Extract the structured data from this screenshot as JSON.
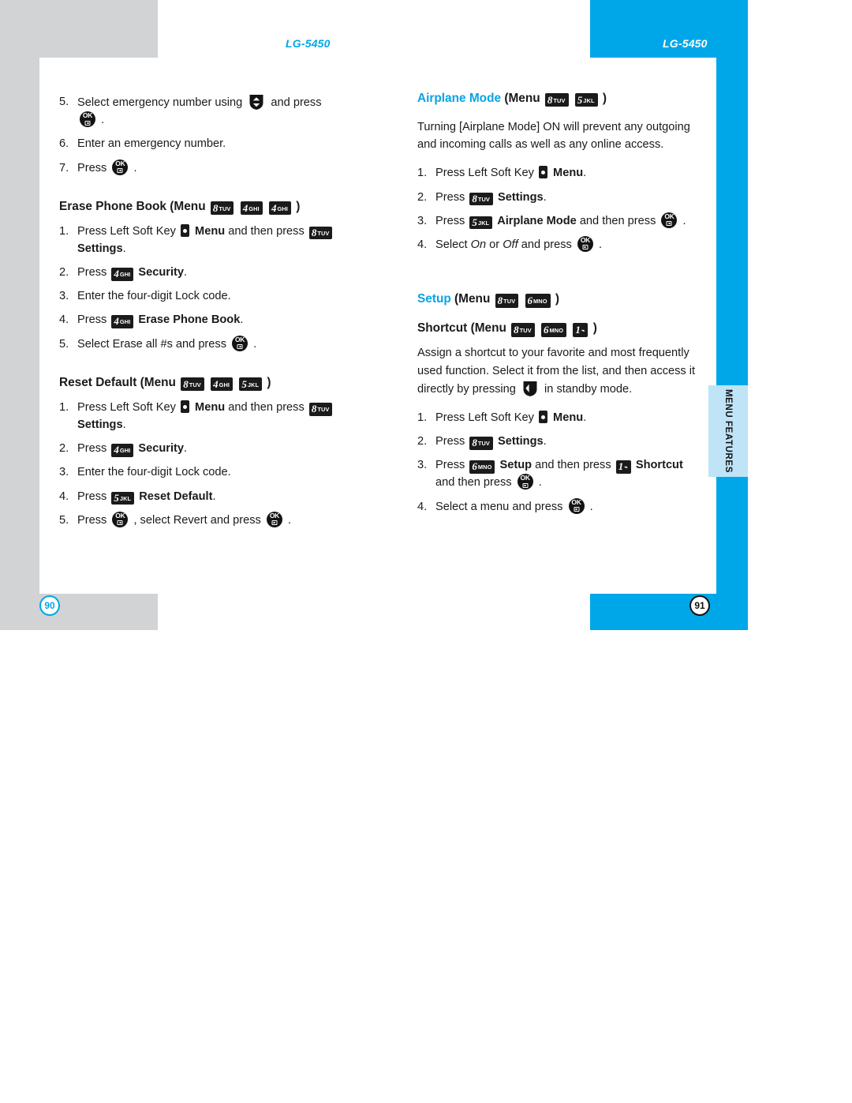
{
  "document": {
    "running_head_left": "LG-5450",
    "running_head_right": "LG-5450",
    "folio_left": "90",
    "folio_right": "91",
    "thumb_tab": "Menu Features"
  },
  "colors": {
    "accent_blue": "#00a7e8",
    "tab_light_blue": "#bfe3f7",
    "page_gray": "#d2d3d4",
    "key_black": "#1b1b1b"
  },
  "left_page": {
    "continued_steps": [
      {
        "num": "5.",
        "a": "Select emergency number using",
        "b": "and press",
        "c": "."
      },
      {
        "num": "6.",
        "a": "Enter an emergency number."
      },
      {
        "num": "7.",
        "a": "Press",
        "c": "."
      }
    ],
    "erase_phone_book": {
      "title": "Erase Phone Book",
      "paren_open": "(Menu",
      "paren_close": ")",
      "keys": [
        {
          "digit": "8",
          "letters": "TUV"
        },
        {
          "digit": "4",
          "letters": "GHI"
        },
        {
          "digit": "4",
          "letters": "GHI"
        }
      ],
      "steps": [
        {
          "num": "1.",
          "a": "Press Left Soft Key",
          "b": "Menu",
          "c": "and then press",
          "d": "Settings",
          "e": "."
        },
        {
          "num": "2.",
          "a": "Press",
          "b": "Security",
          "c": "."
        },
        {
          "num": "3.",
          "a": "Enter the four-digit Lock code."
        },
        {
          "num": "4.",
          "a": "Press",
          "b": "Erase Phone Book",
          "c": "."
        },
        {
          "num": "5.",
          "a": "Select Erase all #s and press",
          "c": "."
        }
      ],
      "step1_key": {
        "digit": "8",
        "letters": "TUV"
      },
      "step2_key": {
        "digit": "4",
        "letters": "GHI"
      },
      "step4_key": {
        "digit": "4",
        "letters": "GHI"
      }
    },
    "reset_default": {
      "title": "Reset Default",
      "paren_open": "(Menu",
      "paren_close": ")",
      "keys": [
        {
          "digit": "8",
          "letters": "TUV"
        },
        {
          "digit": "4",
          "letters": "GHI"
        },
        {
          "digit": "5",
          "letters": "JKL"
        }
      ],
      "steps": [
        {
          "num": "1.",
          "a": "Press Left Soft Key",
          "b": "Menu",
          "c": "and then press",
          "d": "Settings",
          "e": "."
        },
        {
          "num": "2.",
          "a": "Press",
          "b": "Security",
          "c": "."
        },
        {
          "num": "3.",
          "a": "Enter the four-digit Lock code."
        },
        {
          "num": "4.",
          "a": "Press",
          "b": "Reset Default",
          "c": "."
        },
        {
          "num": "5.",
          "a": "Press",
          "b": ", select Revert and press",
          "c": "."
        }
      ],
      "step1_key": {
        "digit": "8",
        "letters": "TUV"
      },
      "step2_key": {
        "digit": "4",
        "letters": "GHI"
      },
      "step4_key": {
        "digit": "5",
        "letters": "JKL"
      }
    }
  },
  "right_page": {
    "airplane_mode": {
      "title": "Airplane Mode",
      "paren_open": "(Menu",
      "paren_close": ")",
      "keys": [
        {
          "digit": "8",
          "letters": "TUV"
        },
        {
          "digit": "5",
          "letters": "JKL"
        }
      ],
      "body": "Turning [Airplane Mode] ON will prevent any outgoing and incoming calls as well as any online access.",
      "steps": [
        {
          "num": "1.",
          "a": "Press Left Soft Key",
          "b": "Menu",
          "c": "."
        },
        {
          "num": "2.",
          "a": "Press",
          "b": "Settings",
          "c": "."
        },
        {
          "num": "3.",
          "a": "Press",
          "b": "Airplane Mode",
          "c": "and then press",
          "e": "."
        },
        {
          "num": "4.",
          "a": "Select",
          "b": "On",
          "c": "or",
          "d": "Off",
          "e": "and press",
          "f": "."
        }
      ],
      "step2_key": {
        "digit": "8",
        "letters": "TUV"
      },
      "step3_key": {
        "digit": "5",
        "letters": "JKL"
      }
    },
    "setup": {
      "title": "Setup",
      "paren_open": "(Menu",
      "paren_close": ")",
      "keys": [
        {
          "digit": "8",
          "letters": "TUV"
        },
        {
          "digit": "6",
          "letters": "MNO"
        }
      ]
    },
    "shortcut": {
      "title": "Shortcut",
      "paren_open": "(Menu",
      "paren_close": ")",
      "keys": [
        {
          "digit": "8",
          "letters": "TUV"
        },
        {
          "digit": "6",
          "letters": "MNO"
        },
        {
          "digit": "1",
          "letters": ""
        }
      ],
      "body_a": "Assign a shortcut to your favorite and most frequently used function. Select it from the list, and then access it directly by pressing",
      "body_b": "in standby mode.",
      "steps": [
        {
          "num": "1.",
          "a": "Press Left Soft Key",
          "b": "Menu",
          "c": "."
        },
        {
          "num": "2.",
          "a": "Press",
          "b": "Settings",
          "c": "."
        },
        {
          "num": "3.",
          "a": "Press",
          "b": "Setup",
          "c": "and then press",
          "d": "Shortcut",
          "e": "and then press",
          "f": "."
        },
        {
          "num": "4.",
          "a": "Select a menu and press",
          "f": "."
        }
      ],
      "step2_key": {
        "digit": "8",
        "letters": "TUV"
      },
      "step3_key_a": {
        "digit": "6",
        "letters": "MNO"
      },
      "step3_key_b": {
        "digit": "1",
        "letters": ""
      }
    }
  }
}
